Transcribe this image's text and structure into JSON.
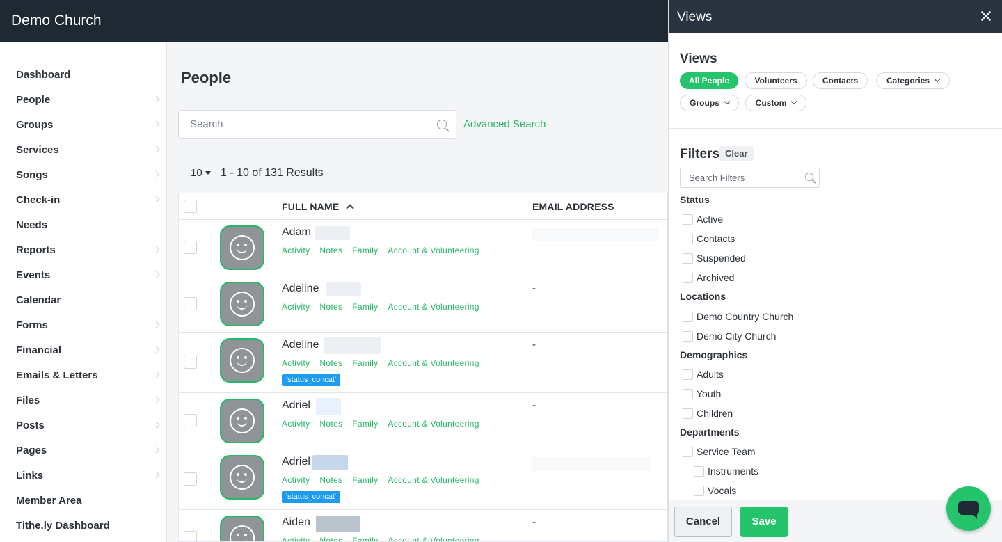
{
  "app": {
    "brand": "Demo Church"
  },
  "sidebar": {
    "items": [
      {
        "label": "Dashboard",
        "chevron": false
      },
      {
        "label": "People",
        "chevron": true
      },
      {
        "label": "Groups",
        "chevron": true
      },
      {
        "label": "Services",
        "chevron": true
      },
      {
        "label": "Songs",
        "chevron": true
      },
      {
        "label": "Check-in",
        "chevron": true
      },
      {
        "label": "Needs",
        "chevron": false
      },
      {
        "label": "Reports",
        "chevron": true
      },
      {
        "label": "Events",
        "chevron": true
      },
      {
        "label": "Calendar",
        "chevron": false
      },
      {
        "label": "Forms",
        "chevron": true
      },
      {
        "label": "Financial",
        "chevron": true
      },
      {
        "label": "Emails & Letters",
        "chevron": true
      },
      {
        "label": "Files",
        "chevron": true
      },
      {
        "label": "Posts",
        "chevron": true
      },
      {
        "label": "Pages",
        "chevron": true
      },
      {
        "label": "Links",
        "chevron": true
      },
      {
        "label": "Member Area",
        "chevron": false
      },
      {
        "label": "Tithe.ly Dashboard",
        "chevron": false
      }
    ]
  },
  "main": {
    "title": "People",
    "search_placeholder": "Search",
    "advanced_search": "Advanced Search",
    "per_page": "10",
    "results": "1 - 10 of 131 Results",
    "columns": {
      "name": "FULL NAME",
      "email": "EMAIL ADDRESS"
    },
    "row_links": [
      "Activity",
      "Notes",
      "Family",
      "Account & Volunteering"
    ],
    "rows": [
      {
        "name": "Adam",
        "email": "",
        "badge": ""
      },
      {
        "name": "Adeline",
        "email": "-",
        "badge": ""
      },
      {
        "name": "Adeline",
        "email": "-",
        "badge": "'status_concat'"
      },
      {
        "name": "Adriel",
        "email": "-",
        "badge": ""
      },
      {
        "name": "Adriel",
        "email": "",
        "badge": "'status_concat'"
      },
      {
        "name": "Aiden",
        "email": "-",
        "badge": ""
      }
    ]
  },
  "drawer": {
    "title": "Views",
    "views_title": "Views",
    "views": [
      "All People",
      "Volunteers",
      "Contacts",
      "Categories",
      "Groups",
      "Custom"
    ],
    "filters_title": "Filters",
    "clear": "Clear",
    "filter_search_placeholder": "Search Filters",
    "groups": [
      {
        "title": "Status",
        "options": [
          "Active",
          "Contacts",
          "Suspended",
          "Archived"
        ]
      },
      {
        "title": "Locations",
        "options": [
          "Demo Country Church",
          "Demo City Church"
        ]
      },
      {
        "title": "Demographics",
        "options": [
          "Adults",
          "Youth",
          "Children"
        ]
      },
      {
        "title": "Departments",
        "options": [
          "Service Team",
          "Instruments",
          "Vocals"
        ]
      }
    ],
    "cancel": "Cancel",
    "save": "Save"
  },
  "colors": {
    "accent": "#25c36b",
    "topbar": "#1f2933",
    "badge": "#1d9bf0"
  }
}
